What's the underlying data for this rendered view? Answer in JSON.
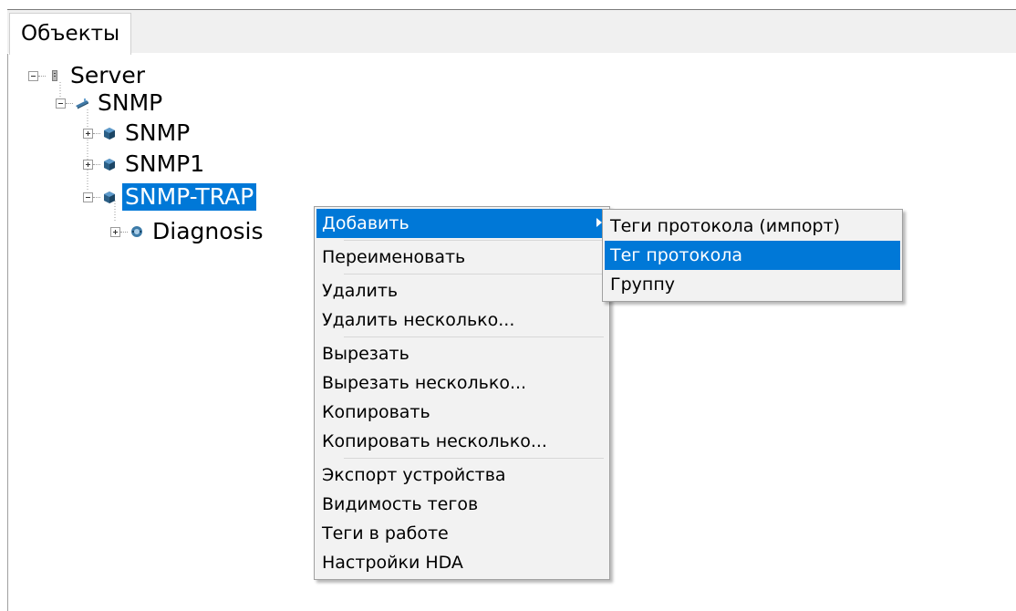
{
  "tab": {
    "label": "Объекты"
  },
  "tree": {
    "server": "Server",
    "snmp_root": "SNMP",
    "snmp_child": "SNMP",
    "snmp1": "SNMP1",
    "snmp_trap": "SNMP-TRAP",
    "diagnosis": "Diagnosis"
  },
  "context_menu": {
    "items": [
      "Добавить",
      "Переименовать",
      "Удалить",
      "Удалить несколько...",
      "Вырезать",
      "Вырезать несколько...",
      "Копировать",
      "Копировать несколько...",
      "Экспорт устройства",
      "Видимость тегов",
      "Теги в работе",
      "Настройки HDA"
    ]
  },
  "submenu": {
    "items": [
      "Теги протокола (импорт)",
      "Тег протокола",
      "Группу"
    ]
  },
  "colors": {
    "selection": "#0078d7",
    "menu_bg": "#f2f2f2"
  },
  "icons": {
    "server": "server-icon",
    "channel": "channel-icon",
    "device": "device-icon",
    "diagnosis": "diagnosis-icon"
  }
}
